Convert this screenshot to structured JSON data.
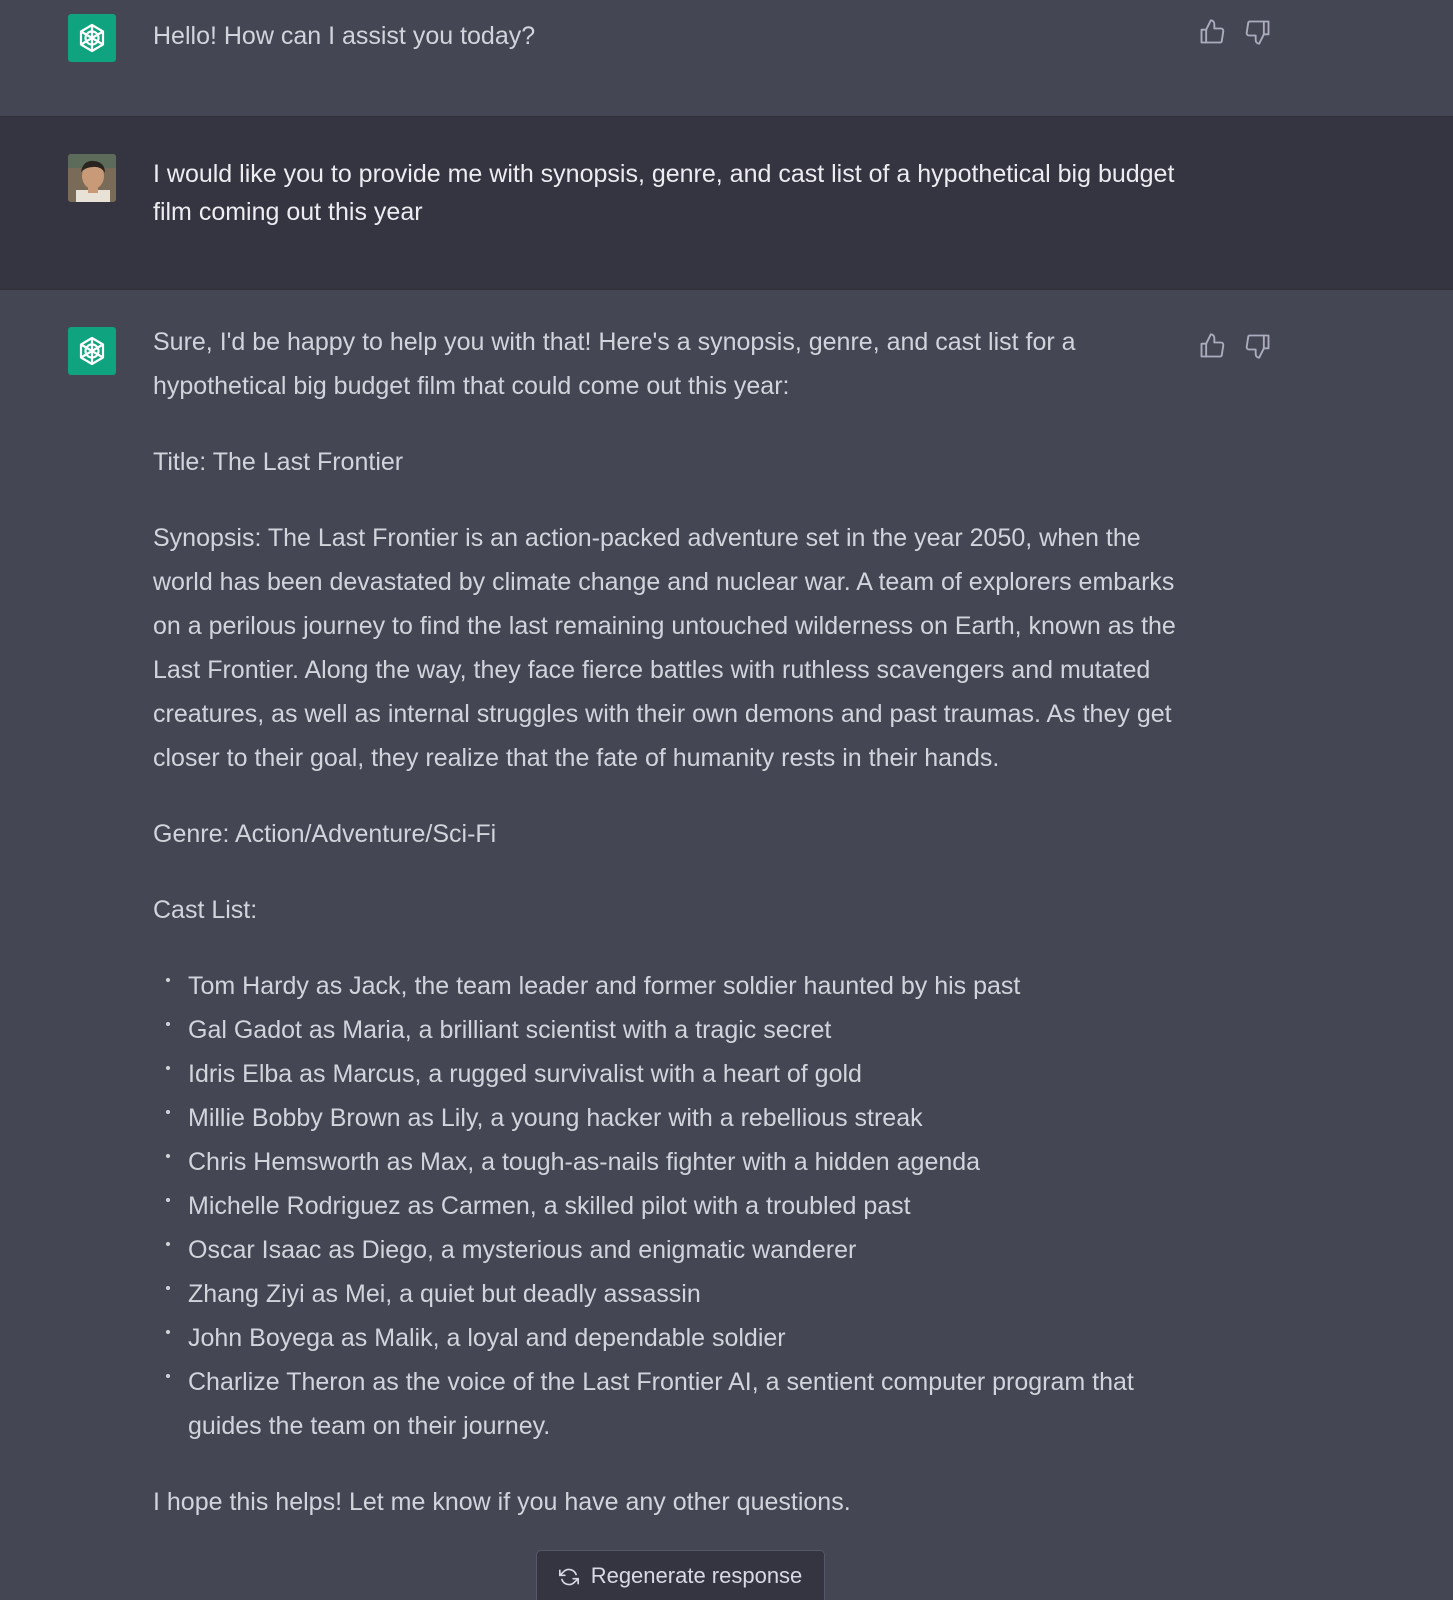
{
  "messages": [
    {
      "role": "assistant",
      "text": "Hello! How can I assist you today?"
    },
    {
      "role": "user",
      "text": "I would like you to provide me with synopsis, genre, and cast list of a hypothetical big budget film coming out this year"
    },
    {
      "role": "assistant",
      "intro": "Sure, I'd be happy to help you with that! Here's a synopsis, genre, and cast list for a hypothetical big budget film that could come out this year:",
      "title_line": "Title: The Last Frontier",
      "synopsis": "Synopsis: The Last Frontier is an action-packed adventure set in the year 2050, when the world has been devastated by climate change and nuclear war. A team of explorers embarks on a perilous journey to find the last remaining untouched wilderness on Earth, known as the Last Frontier. Along the way, they face fierce battles with ruthless scavengers and mutated creatures, as well as internal struggles with their own demons and past traumas. As they get closer to their goal, they realize that the fate of humanity rests in their hands.",
      "genre_line": "Genre: Action/Adventure/Sci-Fi",
      "cast_heading": "Cast List:",
      "cast": [
        "Tom Hardy as Jack, the team leader and former soldier haunted by his past",
        "Gal Gadot as Maria, a brilliant scientist with a tragic secret",
        "Idris Elba as Marcus, a rugged survivalist with a heart of gold",
        "Millie Bobby Brown as Lily, a young hacker with a rebellious streak",
        "Chris Hemsworth as Max, a tough-as-nails fighter with a hidden agenda",
        "Michelle Rodriguez as Carmen, a skilled pilot with a troubled past",
        "Oscar Isaac as Diego, a mysterious and enigmatic wanderer",
        "Zhang Ziyi as Mei, a quiet but deadly assassin",
        "John Boyega as Malik, a loyal and dependable soldier",
        "Charlize Theron as the voice of the Last Frontier AI, a sentient computer program that guides the team on their journey."
      ],
      "closing": "I hope this helps! Let me know if you have any other questions."
    }
  ],
  "regenerate_label": "Regenerate response",
  "colors": {
    "assistant_bg": "#444654",
    "user_bg": "#343541",
    "bot_avatar": "#10a37f",
    "text": "#d1d5db"
  },
  "icons": {
    "like": "thumbs-up-icon",
    "dislike": "thumbs-down-icon",
    "regenerate": "refresh-icon",
    "bot": "openai-logo-icon"
  }
}
